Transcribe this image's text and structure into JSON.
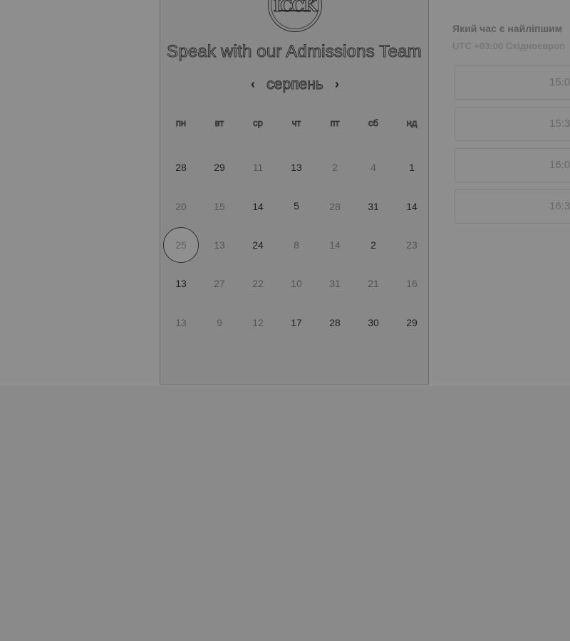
{
  "calendar": {
    "logo_text": "ICCK",
    "title": "Speak with our Admissions Team",
    "month": "серпень",
    "prev_icon": "chevron-left-icon",
    "next_icon": "chevron-right-icon",
    "weekdays": [
      "пн",
      "вт",
      "ср",
      "чт",
      "пт",
      "сб",
      "нд"
    ],
    "weeks": [
      [
        "28",
        "29",
        "11",
        "13",
        "2",
        "4",
        "1"
      ],
      [
        "20",
        "15",
        "14",
        "5",
        "28",
        "31",
        "14"
      ],
      [
        "25",
        "13",
        "24",
        "8",
        "14",
        "2",
        "23"
      ],
      [
        "13",
        "27",
        "22",
        "10",
        "31",
        "21",
        "16"
      ],
      [
        "13",
        "9",
        "12",
        "17",
        "28",
        "30",
        "29"
      ]
    ],
    "selected_day": "25"
  },
  "times": {
    "question": "Який час є найліпшим",
    "timezone": "UTC +03:00 Східноєвроп",
    "slots": [
      "15:0",
      "15:3",
      "16:0",
      "16:3"
    ]
  },
  "colors": {
    "overlay": "#8e8e8e",
    "panel": "#888888",
    "text": "#1f1f1f"
  }
}
